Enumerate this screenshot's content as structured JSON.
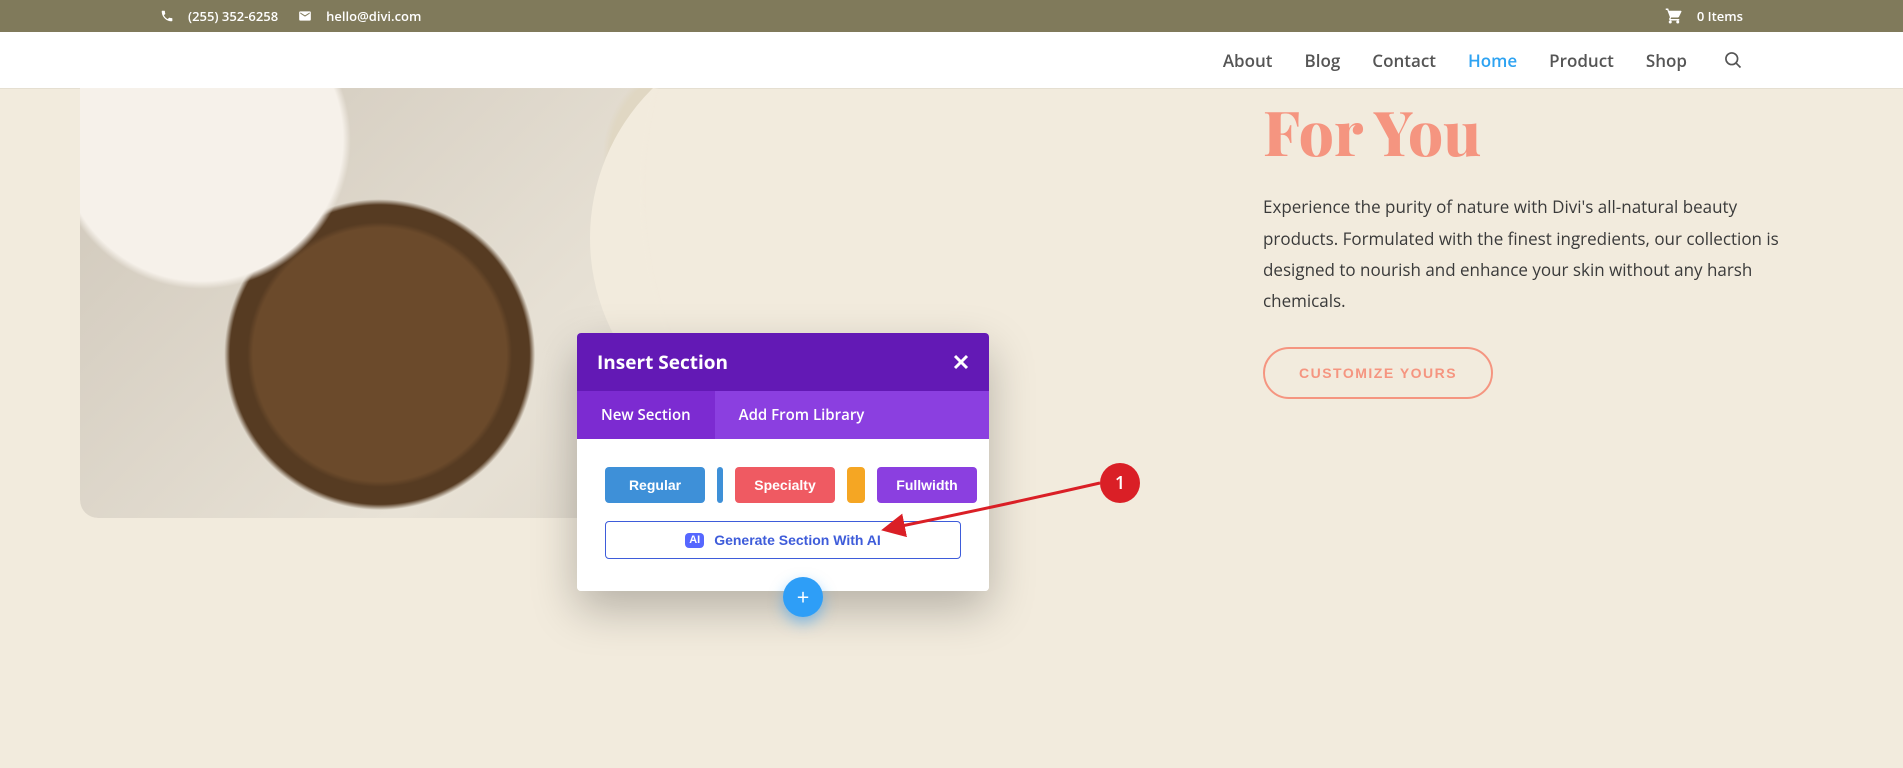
{
  "topbar": {
    "phone": "(255) 352-6258",
    "email": "hello@divi.com",
    "cart_label": "0 Items"
  },
  "nav": {
    "items": [
      {
        "label": "About"
      },
      {
        "label": "Blog"
      },
      {
        "label": "Contact"
      },
      {
        "label": "Home",
        "active": true
      },
      {
        "label": "Product"
      },
      {
        "label": "Shop"
      }
    ]
  },
  "hero": {
    "title": "For You",
    "body": "Experience the purity of nature with Divi's all-natural beauty products. Formulated with the finest ingredients, our collection is designed to nourish and enhance your skin without any harsh chemicals.",
    "cta": "CUSTOMIZE YOURS"
  },
  "modal": {
    "title": "Insert Section",
    "tabs": {
      "new_section": "New Section",
      "add_from_library": "Add From Library"
    },
    "buttons": {
      "regular": "Regular",
      "specialty": "Specialty",
      "fullwidth": "Fullwidth",
      "generate_ai": "Generate Section With AI",
      "ai_badge": "AI"
    }
  },
  "annotation": {
    "number": "1"
  },
  "fab": {
    "plus": "+"
  }
}
